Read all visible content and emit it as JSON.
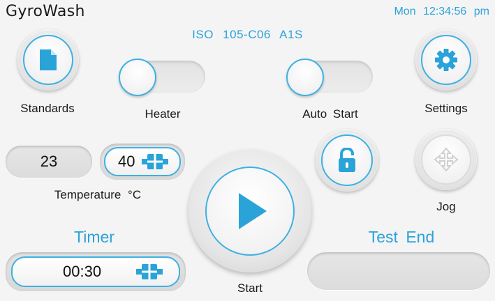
{
  "header": {
    "brand": "GyroWash",
    "clock": "Mon 12:34:56 pm",
    "standard_code": "ISO 105-C06 A1S"
  },
  "buttons": {
    "standards": {
      "label": "Standards",
      "icon": "document-icon"
    },
    "settings": {
      "label": "Settings",
      "icon": "gear-icon"
    },
    "lock": {
      "icon": "unlock-icon"
    },
    "jog": {
      "label": "Jog",
      "icon": "move-arrows-icon"
    },
    "start": {
      "label": "Start",
      "icon": "play-icon"
    }
  },
  "toggles": {
    "heater": {
      "label": "Heater",
      "on": false
    },
    "auto_start": {
      "label": "Auto Start",
      "on": false
    }
  },
  "temperature": {
    "current": "23",
    "setpoint": "40",
    "label": "Temperature °C"
  },
  "timer": {
    "title": "Timer",
    "value": "00:30"
  },
  "test_end": {
    "title": "Test End",
    "value": ""
  },
  "colors": {
    "accent": "#2aa3d8",
    "background": "#f4f4f4"
  }
}
